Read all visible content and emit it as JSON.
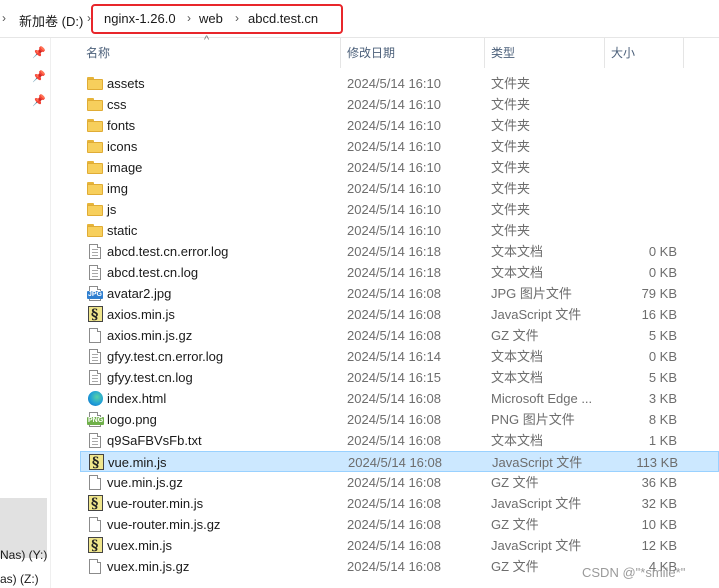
{
  "breadcrumb": {
    "drive": "新加卷 (D:)",
    "parts": [
      "nginx-1.26.0",
      "web",
      "abcd.test.cn"
    ]
  },
  "nav": {
    "drives": [
      "Nas) (Y:)",
      "as) (Z:)"
    ]
  },
  "columns": {
    "name": "名称",
    "date": "修改日期",
    "type": "类型",
    "size": "大小"
  },
  "files": [
    {
      "name": "assets",
      "date": "2024/5/14 16:10",
      "type": "文件夹",
      "size": "",
      "icon": "folder"
    },
    {
      "name": "css",
      "date": "2024/5/14 16:10",
      "type": "文件夹",
      "size": "",
      "icon": "folder"
    },
    {
      "name": "fonts",
      "date": "2024/5/14 16:10",
      "type": "文件夹",
      "size": "",
      "icon": "folder"
    },
    {
      "name": "icons",
      "date": "2024/5/14 16:10",
      "type": "文件夹",
      "size": "",
      "icon": "folder"
    },
    {
      "name": "image",
      "date": "2024/5/14 16:10",
      "type": "文件夹",
      "size": "",
      "icon": "folder"
    },
    {
      "name": "img",
      "date": "2024/5/14 16:10",
      "type": "文件夹",
      "size": "",
      "icon": "folder"
    },
    {
      "name": "js",
      "date": "2024/5/14 16:10",
      "type": "文件夹",
      "size": "",
      "icon": "folder"
    },
    {
      "name": "static",
      "date": "2024/5/14 16:10",
      "type": "文件夹",
      "size": "",
      "icon": "folder"
    },
    {
      "name": "abcd.test.cn.error.log",
      "date": "2024/5/14 16:18",
      "type": "文本文档",
      "size": "0 KB",
      "icon": "text"
    },
    {
      "name": "abcd.test.cn.log",
      "date": "2024/5/14 16:18",
      "type": "文本文档",
      "size": "0 KB",
      "icon": "text"
    },
    {
      "name": "avatar2.jpg",
      "date": "2024/5/14 16:08",
      "type": "JPG 图片文件",
      "size": "79 KB",
      "icon": "jpg"
    },
    {
      "name": "axios.min.js",
      "date": "2024/5/14 16:08",
      "type": "JavaScript 文件",
      "size": "16 KB",
      "icon": "js"
    },
    {
      "name": "axios.min.js.gz",
      "date": "2024/5/14 16:08",
      "type": "GZ 文件",
      "size": "5 KB",
      "icon": "blank"
    },
    {
      "name": "gfyy.test.cn.error.log",
      "date": "2024/5/14 16:14",
      "type": "文本文档",
      "size": "0 KB",
      "icon": "text"
    },
    {
      "name": "gfyy.test.cn.log",
      "date": "2024/5/14 16:15",
      "type": "文本文档",
      "size": "5 KB",
      "icon": "text"
    },
    {
      "name": "index.html",
      "date": "2024/5/14 16:08",
      "type": "Microsoft Edge ...",
      "size": "3 KB",
      "icon": "edge"
    },
    {
      "name": "logo.png",
      "date": "2024/5/14 16:08",
      "type": "PNG 图片文件",
      "size": "8 KB",
      "icon": "png"
    },
    {
      "name": "q9SaFBVsFb.txt",
      "date": "2024/5/14 16:08",
      "type": "文本文档",
      "size": "1 KB",
      "icon": "text"
    },
    {
      "name": "vue.min.js",
      "date": "2024/5/14 16:08",
      "type": "JavaScript 文件",
      "size": "113 KB",
      "icon": "js",
      "selected": true
    },
    {
      "name": "vue.min.js.gz",
      "date": "2024/5/14 16:08",
      "type": "GZ 文件",
      "size": "36 KB",
      "icon": "blank"
    },
    {
      "name": "vue-router.min.js",
      "date": "2024/5/14 16:08",
      "type": "JavaScript 文件",
      "size": "32 KB",
      "icon": "js"
    },
    {
      "name": "vue-router.min.js.gz",
      "date": "2024/5/14 16:08",
      "type": "GZ 文件",
      "size": "10 KB",
      "icon": "blank"
    },
    {
      "name": "vuex.min.js",
      "date": "2024/5/14 16:08",
      "type": "JavaScript 文件",
      "size": "12 KB",
      "icon": "js"
    },
    {
      "name": "vuex.min.js.gz",
      "date": "2024/5/14 16:08",
      "type": "GZ 文件",
      "size": "4 KB",
      "icon": "blank"
    }
  ],
  "watermark": "CSDN @\"*smile*\"",
  "colors": {
    "highlight": "#e8262b",
    "selection": "#cce8ff",
    "folder": "#f7cf5c"
  }
}
